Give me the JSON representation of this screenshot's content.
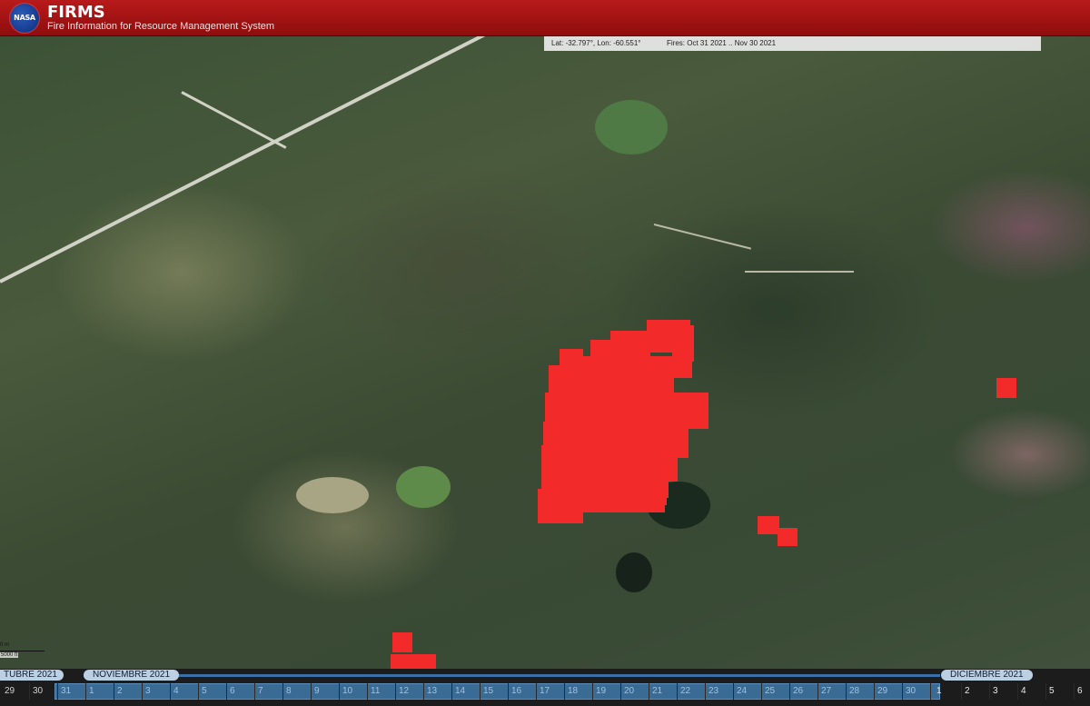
{
  "header": {
    "logo_text": "NASA",
    "title": "FIRMS",
    "subtitle": "Fire Information for Resource Management System"
  },
  "map": {
    "coords": "Lat: -32.797°, Lon: -60.551°",
    "fires_range": "Fires: Oct 31 2021 .. Nov 30 2021",
    "scale_top": "0 m",
    "scale_bottom": "5000 ft",
    "fire_color": "#f22a2a"
  },
  "timeline": {
    "months": [
      "TUBRE 2021",
      "NOVIEMBRE 2021",
      "DICIEMBRE 2021"
    ],
    "days_before": [
      "29",
      "30"
    ],
    "days_active": [
      "31",
      "1",
      "2",
      "3",
      "4",
      "5",
      "6",
      "7",
      "8",
      "9",
      "10",
      "11",
      "12",
      "13",
      "14",
      "15",
      "16",
      "17",
      "18",
      "19",
      "20",
      "21",
      "22",
      "23",
      "24",
      "25",
      "26",
      "27",
      "28",
      "29",
      "30"
    ],
    "days_after": [
      "1",
      "2",
      "3",
      "4",
      "5",
      "6"
    ]
  }
}
